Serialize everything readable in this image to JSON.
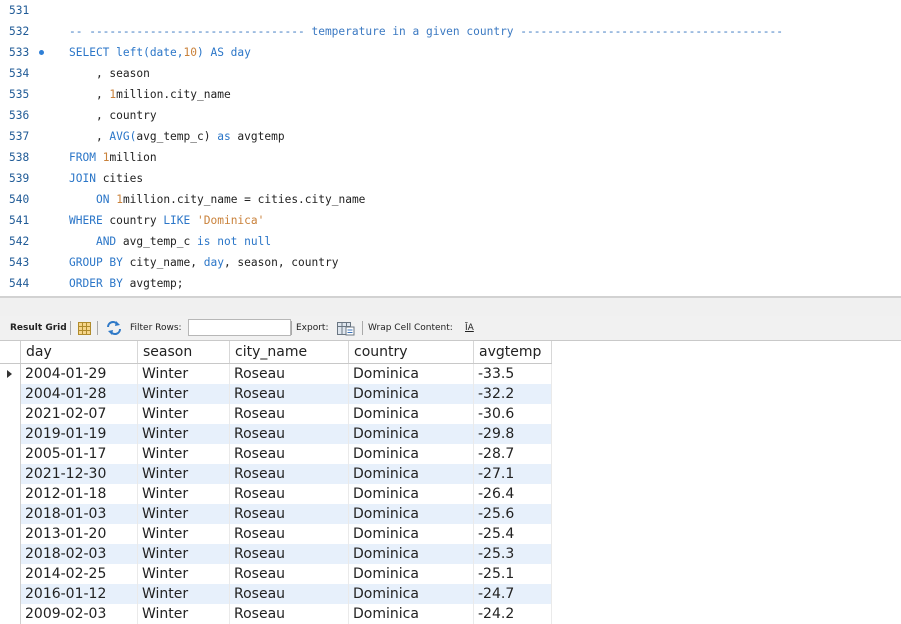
{
  "editor": {
    "lines": [
      {
        "num": "531",
        "segments": []
      },
      {
        "num": "532",
        "segments": [
          {
            "t": "-- -------------------------------- temperature in a given country ---------------------------------------",
            "c": "cm"
          }
        ]
      },
      {
        "num": "533",
        "breakpoint": true,
        "segments": [
          {
            "t": "SELECT left(date,",
            "c": "kw"
          },
          {
            "t": "10",
            "c": "num"
          },
          {
            "t": ") AS day",
            "c": "kw"
          }
        ]
      },
      {
        "num": "534",
        "segments": [
          {
            "t": "    , season",
            "c": ""
          }
        ]
      },
      {
        "num": "535",
        "segments": [
          {
            "t": "    , ",
            "c": ""
          },
          {
            "t": "1",
            "c": "num"
          },
          {
            "t": "million.city_name",
            "c": ""
          }
        ]
      },
      {
        "num": "536",
        "segments": [
          {
            "t": "    , country",
            "c": ""
          }
        ]
      },
      {
        "num": "537",
        "segments": [
          {
            "t": "    , ",
            "c": ""
          },
          {
            "t": "AVG(",
            "c": "kw"
          },
          {
            "t": "avg_temp_c) ",
            "c": ""
          },
          {
            "t": "as",
            "c": "kw"
          },
          {
            "t": " avgtemp",
            "c": ""
          }
        ]
      },
      {
        "num": "538",
        "segments": [
          {
            "t": "FROM ",
            "c": "kw"
          },
          {
            "t": "1",
            "c": "num"
          },
          {
            "t": "million",
            "c": ""
          }
        ]
      },
      {
        "num": "539",
        "segments": [
          {
            "t": "JOIN",
            "c": "kw"
          },
          {
            "t": " cities",
            "c": ""
          }
        ]
      },
      {
        "num": "540",
        "segments": [
          {
            "t": "    ",
            "c": ""
          },
          {
            "t": "ON",
            "c": "kw"
          },
          {
            "t": " ",
            "c": ""
          },
          {
            "t": "1",
            "c": "num"
          },
          {
            "t": "million.city_name = cities.city_name",
            "c": ""
          }
        ]
      },
      {
        "num": "541",
        "segments": [
          {
            "t": "WHERE",
            "c": "kw"
          },
          {
            "t": " country ",
            "c": ""
          },
          {
            "t": "LIKE",
            "c": "kw"
          },
          {
            "t": " ",
            "c": ""
          },
          {
            "t": "'Dominica'",
            "c": "str"
          }
        ]
      },
      {
        "num": "542",
        "segments": [
          {
            "t": "    ",
            "c": ""
          },
          {
            "t": "AND",
            "c": "kw"
          },
          {
            "t": " avg_temp_c ",
            "c": ""
          },
          {
            "t": "is not null",
            "c": "kw"
          }
        ]
      },
      {
        "num": "543",
        "segments": [
          {
            "t": "GROUP BY",
            "c": "kw"
          },
          {
            "t": " city_name, ",
            "c": ""
          },
          {
            "t": "day",
            "c": "kw"
          },
          {
            "t": ", season, country",
            "c": ""
          }
        ]
      },
      {
        "num": "544",
        "segments": [
          {
            "t": "ORDER BY",
            "c": "kw"
          },
          {
            "t": " avgtemp;",
            "c": ""
          }
        ]
      }
    ]
  },
  "toolbar": {
    "result_grid_label": "Result Grid",
    "filter_rows_label": "Filter Rows:",
    "filter_value": "",
    "export_label": "Export:",
    "wrap_label": "Wrap Cell Content:",
    "wrap_icon_text": "ĪA"
  },
  "grid": {
    "columns": [
      "day",
      "season",
      "city_name",
      "country",
      "avgtemp"
    ],
    "rows": [
      [
        "2004-01-29",
        "Winter",
        "Roseau",
        "Dominica",
        "-33.5"
      ],
      [
        "2004-01-28",
        "Winter",
        "Roseau",
        "Dominica",
        "-32.2"
      ],
      [
        "2021-02-07",
        "Winter",
        "Roseau",
        "Dominica",
        "-30.6"
      ],
      [
        "2019-01-19",
        "Winter",
        "Roseau",
        "Dominica",
        "-29.8"
      ],
      [
        "2005-01-17",
        "Winter",
        "Roseau",
        "Dominica",
        "-28.7"
      ],
      [
        "2021-12-30",
        "Winter",
        "Roseau",
        "Dominica",
        "-27.1"
      ],
      [
        "2012-01-18",
        "Winter",
        "Roseau",
        "Dominica",
        "-26.4"
      ],
      [
        "2018-01-03",
        "Winter",
        "Roseau",
        "Dominica",
        "-25.6"
      ],
      [
        "2013-01-20",
        "Winter",
        "Roseau",
        "Dominica",
        "-25.4"
      ],
      [
        "2018-02-03",
        "Winter",
        "Roseau",
        "Dominica",
        "-25.3"
      ],
      [
        "2014-02-25",
        "Winter",
        "Roseau",
        "Dominica",
        "-25.1"
      ],
      [
        "2016-01-12",
        "Winter",
        "Roseau",
        "Dominica",
        "-24.7"
      ],
      [
        "2009-02-03",
        "Winter",
        "Roseau",
        "Dominica",
        "-24.2"
      ]
    ]
  },
  "colors": {
    "keyword": "#2b76c8",
    "number": "#c9813a",
    "line_number": "#1f5a96",
    "row_stripe": "#e7f0fb"
  }
}
